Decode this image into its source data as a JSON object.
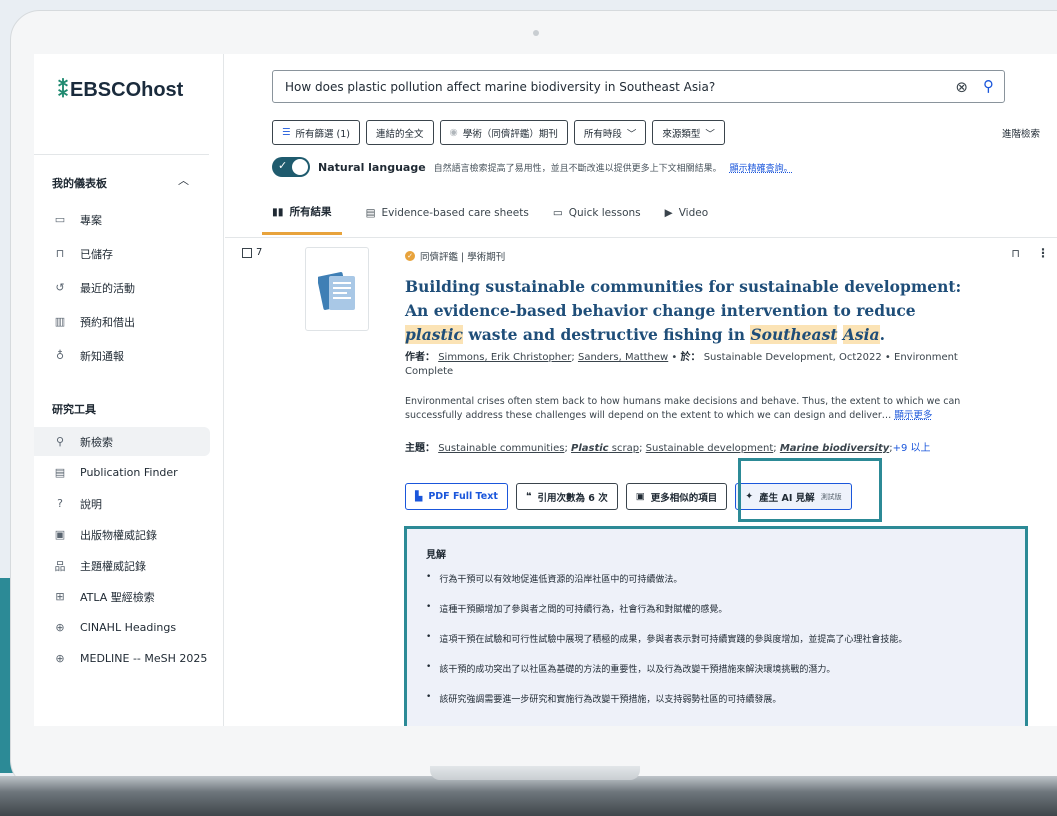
{
  "app": {
    "logo": "EBSCOhost",
    "logo_mark": "⁑"
  },
  "sidebar": {
    "dashboard_heading": "我的儀表板",
    "dashboard_items": [
      {
        "label": "專案",
        "icon": "folder-icon"
      },
      {
        "label": "已儲存",
        "icon": "bookmark-icon"
      },
      {
        "label": "最近的活動",
        "icon": "history-icon"
      },
      {
        "label": "預約和借出",
        "icon": "books-icon"
      },
      {
        "label": "新知通報",
        "icon": "bell-icon"
      }
    ],
    "tools_heading": "研究工具",
    "tools_items": [
      {
        "label": "新檢索",
        "icon": "search-icon"
      },
      {
        "label": "Publication Finder",
        "icon": "document-icon"
      },
      {
        "label": "說明",
        "icon": "help-icon"
      },
      {
        "label": "出版物權威記錄",
        "icon": "book-icon"
      },
      {
        "label": "主題權威記錄",
        "icon": "hierarchy-icon"
      },
      {
        "label": "ATLA 聖經檢索",
        "icon": "bible-icon"
      },
      {
        "label": "CINAHL Headings",
        "icon": "medical-book-icon"
      },
      {
        "label": "MEDLINE -- MeSH 2025",
        "icon": "medical-book-icon"
      }
    ]
  },
  "search": {
    "query": "How does plastic pollution affect marine biodiversity in Southeast Asia?"
  },
  "filters": {
    "all_filters": "所有篩選 (1)",
    "linked_full_text": "連結的全文",
    "peer_reviewed": "學術（同儕評鑑）期刊",
    "all_time": "所有時段",
    "source_type": "來源類型",
    "advanced": "進階檢索"
  },
  "natural_language": {
    "label": "Natural language",
    "description": "自然語言檢索提高了易用性，並且不斷改進以提供更多上下文相關結果。",
    "link": "顯示精確查詢。"
  },
  "tabs": [
    "所有結果",
    "Evidence-based care sheets",
    "Quick lessons",
    "Video"
  ],
  "result": {
    "number": "7",
    "meta": "同儕評鑑 | 學術期刊",
    "title_part1": "Building sustainable communities for sustainable development: An evidence-based behavior change intervention to reduce ",
    "title_hl1": "plastic",
    "title_part2": " waste and destructive fishing in ",
    "title_hl2": "Southeast",
    "title_hl3": "Asia",
    "authors_label": "作者：",
    "author1": "Simmons, Erik Christopher",
    "author2": "Sanders, Matthew",
    "in_label": "於：",
    "source": "Sustainable Development, Oct2022 • Environment Complete",
    "abstract": "Environmental crises often stem back to how humans make decisions and behave. Thus, the extent to which we can successfully address these challenges will depend on the extent to which we can design and deliver…",
    "show_more": "顯示更多",
    "subjects_label": "主題：",
    "subject1": "Sustainable communities",
    "subject2": "Plastic",
    "subject2_rest": " scrap",
    "subject3": "Sustainable development",
    "subject4": "Marine biodiversity",
    "subjects_more": "+9 以上"
  },
  "actions": {
    "pdf": "PDF Full Text",
    "citations": "引用次數為 6 次",
    "similar": "更多相似的項目",
    "ai": "產生 AI 見解",
    "beta": "測試版"
  },
  "insights": {
    "heading": "見解",
    "items": [
      "行為干預可以有效地促進低資源的沿岸社區中的可持續做法。",
      "這種干預顯增加了參與者之間的可持續行為，社會行為和對賦權的感覺。",
      "這項干預在試驗和可行性試驗中展現了積極的成果，參與者表示對可持續實踐的參與度增加，並提高了心理社會技能。",
      "該干預的成功突出了以社區為基礎的方法的重要性，以及行為改變干預措施來解決環境挑戰的潛力。",
      "該研究強調需要進一步研究和實施行為改變干預措施，以支持弱勢社區的可持續發展。"
    ]
  },
  "colors": {
    "accent": "#1a56db",
    "highlight": "#fbe3b5",
    "frame": "#2c8a96",
    "tab_underline": "#e8a33c"
  }
}
